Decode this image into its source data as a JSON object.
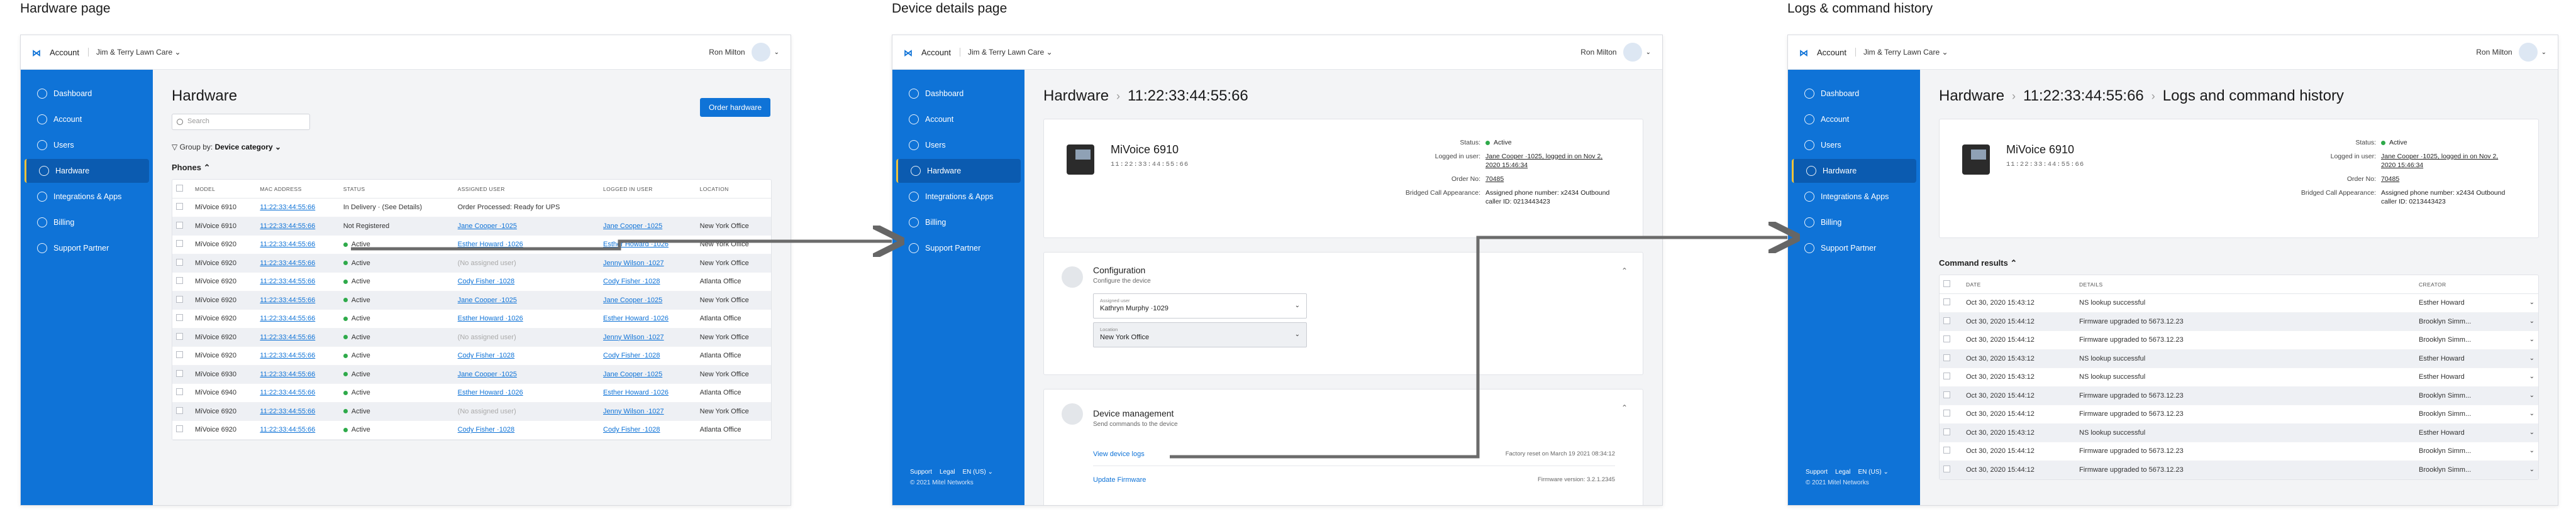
{
  "frames": {
    "hardware": "Hardware page",
    "details": "Device details page",
    "logs": "Logs & command history"
  },
  "topbar": {
    "account": "Account",
    "org": "Jim & Terry Lawn Care  ⌄",
    "user": "Ron Milton",
    "logo_icon": "mitel-logo"
  },
  "sidebar": {
    "items": [
      "Dashboard",
      "Account",
      "Users",
      "Hardware",
      "Integrations & Apps",
      "Billing",
      "Support Partner"
    ],
    "active": "Hardware",
    "footer_links": [
      "Support",
      "Legal",
      "EN (US) ⌄"
    ],
    "copyright": "© 2021 Mitel Networks"
  },
  "hardware_page": {
    "title": "Hardware",
    "search_placeholder": "Search",
    "order_button": "Order hardware",
    "group_by_label": "Group by:",
    "group_by_value": "Device category ⌄",
    "section": "Phones ⌃",
    "columns": [
      "MODEL",
      "MAC ADDRESS",
      "STATUS",
      "ASSIGNED USER",
      "LOGGED IN USER",
      "LOCATION"
    ],
    "rows": [
      {
        "model": "MiVoice 6910",
        "mac": "11:22:33:44:55:66",
        "status": "In Delivery · (See Details)",
        "assigned": "Order Processed: Ready for UPS",
        "logged": "",
        "location": ""
      },
      {
        "model": "MiVoice 6910",
        "mac": "11:22:33:44:55:66",
        "status": "Not Registered",
        "assigned": "Jane Cooper ·1025",
        "logged": "Jane Cooper ·1025",
        "location": "New York Office"
      },
      {
        "model": "MiVoice 6920",
        "mac": "11:22:33:44:55:66",
        "status": "Active",
        "assigned": "Esther Howard ·1026",
        "logged": "Esther Howard ·1026",
        "location": "New York Office"
      },
      {
        "model": "MiVoice 6920",
        "mac": "11:22:33:44:55:66",
        "status": "Active",
        "assigned": "(No assigned user)",
        "logged": "Jenny Wilson ·1027",
        "location": "New York Office"
      },
      {
        "model": "MiVoice 6920",
        "mac": "11:22:33:44:55:66",
        "status": "Active",
        "assigned": "Cody Fisher ·1028",
        "logged": "Cody Fisher ·1028",
        "location": "Atlanta Office"
      },
      {
        "model": "MiVoice 6920",
        "mac": "11:22:33:44:55:66",
        "status": "Active",
        "assigned": "Jane Cooper ·1025",
        "logged": "Jane Cooper ·1025",
        "location": "New York Office"
      },
      {
        "model": "MiVoice 6920",
        "mac": "11:22:33:44:55:66",
        "status": "Active",
        "assigned": "Esther Howard ·1026",
        "logged": "Esther Howard ·1026",
        "location": "Atlanta Office"
      },
      {
        "model": "MiVoice 6920",
        "mac": "11:22:33:44:55:66",
        "status": "Active",
        "assigned": "(No assigned user)",
        "logged": "Jenny Wilson ·1027",
        "location": "New York Office"
      },
      {
        "model": "MiVoice 6920",
        "mac": "11:22:33:44:55:66",
        "status": "Active",
        "assigned": "Cody Fisher ·1028",
        "logged": "Cody Fisher ·1028",
        "location": "Atlanta Office"
      },
      {
        "model": "MiVoice 6930",
        "mac": "11:22:33:44:55:66",
        "status": "Active",
        "assigned": "Jane Cooper ·1025",
        "logged": "Jane Cooper ·1025",
        "location": "New York Office"
      },
      {
        "model": "MiVoice 6940",
        "mac": "11:22:33:44:55:66",
        "status": "Active",
        "assigned": "Esther Howard ·1026",
        "logged": "Esther Howard ·1026",
        "location": "Atlanta Office"
      },
      {
        "model": "MiVoice 6920",
        "mac": "11:22:33:44:55:66",
        "status": "Active",
        "assigned": "(No assigned user)",
        "logged": "Jenny Wilson ·1027",
        "location": "New York Office"
      },
      {
        "model": "MiVoice 6920",
        "mac": "11:22:33:44:55:66",
        "status": "Active",
        "assigned": "Cody Fisher ·1028",
        "logged": "Cody Fisher ·1028",
        "location": "Atlanta Office"
      }
    ]
  },
  "device": {
    "crumb_root": "Hardware",
    "crumb_mac": "11:22:33:44:55:66",
    "crumb_logs": "Logs and command history",
    "name": "MiVoice 6910",
    "mac": "11:22:33:44:55:66",
    "fields": [
      {
        "k": "Status:",
        "v": "Active"
      },
      {
        "k": "Logged in user:",
        "v": "Jane Cooper ·1025, logged in on Nov 2, 2020 15:46:34"
      },
      {
        "k": "Order No:",
        "v": "70485"
      },
      {
        "k": "Bridged Call Appearance:",
        "v": "Assigned phone number: x2434  Outbound caller ID: 0213443423"
      }
    ],
    "config_title": "Configuration",
    "config_sub": "Configure the device",
    "assigned_label": "Assigned user",
    "assigned_value": "Kathryn Murphy ·1029",
    "location_label": "Location",
    "location_value": "New York Office",
    "mgmt_title": "Device management",
    "mgmt_sub": "Send commands to the device",
    "view_logs": "View device logs",
    "factory_reset": "Factory reset on March 19 2021 08:34:12",
    "update_firmware": "Update Firmware",
    "firmware_version": "Firmware version: 3.2.1.2345"
  },
  "logs": {
    "section": "Command results ⌃",
    "columns": [
      "DATE",
      "DETAILS",
      "CREATOR"
    ],
    "rows": [
      {
        "date": "Oct 30, 2020 15:43:12",
        "details": "NS lookup successful",
        "creator": "Esther Howard"
      },
      {
        "date": "Oct 30, 2020 15:44:12",
        "details": "Firmware upgraded to 5673.12.23",
        "creator": "Brooklyn Simm..."
      },
      {
        "date": "Oct 30, 2020 15:44:12",
        "details": "Firmware upgraded to 5673.12.23",
        "creator": "Brooklyn Simm..."
      },
      {
        "date": "Oct 30, 2020 15:43:12",
        "details": "NS lookup successful",
        "creator": "Esther Howard"
      },
      {
        "date": "Oct 30, 2020 15:43:12",
        "details": "NS lookup successful",
        "creator": "Esther Howard"
      },
      {
        "date": "Oct 30, 2020 15:44:12",
        "details": "Firmware upgraded to 5673.12.23",
        "creator": "Brooklyn Simm..."
      },
      {
        "date": "Oct 30, 2020 15:44:12",
        "details": "Firmware upgraded to 5673.12.23",
        "creator": "Brooklyn Simm..."
      },
      {
        "date": "Oct 30, 2020 15:43:12",
        "details": "NS lookup successful",
        "creator": "Esther Howard"
      },
      {
        "date": "Oct 30, 2020 15:44:12",
        "details": "Firmware upgraded to 5673.12.23",
        "creator": "Brooklyn Simm..."
      },
      {
        "date": "Oct 30, 2020 15:44:12",
        "details": "Firmware upgraded to 5673.12.23",
        "creator": "Brooklyn Simm..."
      }
    ]
  },
  "colors": {
    "brand": "#0f73d7",
    "active_nav": "#0b5bb0",
    "active_marker": "#f0c23b",
    "status_active": "#2eaa4a"
  }
}
